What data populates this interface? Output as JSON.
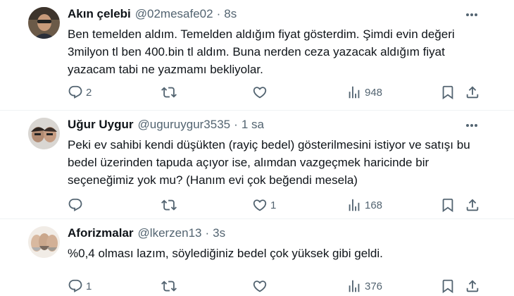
{
  "colors": {
    "text": "#0f1419",
    "muted": "#536471",
    "separator": "#eff3f4"
  },
  "icons": [
    "more-icon",
    "reply-icon",
    "retweet-icon",
    "like-icon",
    "views-icon",
    "bookmark-icon",
    "share-icon"
  ],
  "tweets": [
    {
      "name": "Akın çelebi",
      "handle": "@02mesafe02",
      "dot": "·",
      "time": "8s",
      "lines": [
        "Ben temelden aldım. Temelden aldığım fiyat gösterdim. Şimdi evin değeri",
        "3milyon tl ben 400.bin tl aldım. Buna nerden ceza yazacak aldığım fiyat",
        "yazacam tabi ne yazmamı bekliyolar."
      ],
      "replies": "2",
      "retweets": "",
      "likes": "",
      "views": "948"
    },
    {
      "name": "Uğur Uygur",
      "handle": "@uguruygur3535",
      "dot": "·",
      "time": "1 sa",
      "lines": [
        "Peki ev sahibi kendi düşükten (rayiç bedel) gösterilmesini istiyor ve satışı bu",
        "bedel üzerinden tapuda açıyor ise, alımdan vazgeçmek haricinde bir",
        "seçeneğimiz yok mu? (Hanım evi çok beğendi mesela)"
      ],
      "replies": "",
      "retweets": "",
      "likes": "1",
      "views": "168"
    },
    {
      "name": "Aforizmalar",
      "handle": "@lkerzen13",
      "dot": "·",
      "time": "3s",
      "lines": [
        "%0,4 olması lazım, söylediğiniz bedel çok yüksek gibi geldi."
      ],
      "replies": "1",
      "retweets": "",
      "likes": "",
      "views": "376"
    }
  ]
}
